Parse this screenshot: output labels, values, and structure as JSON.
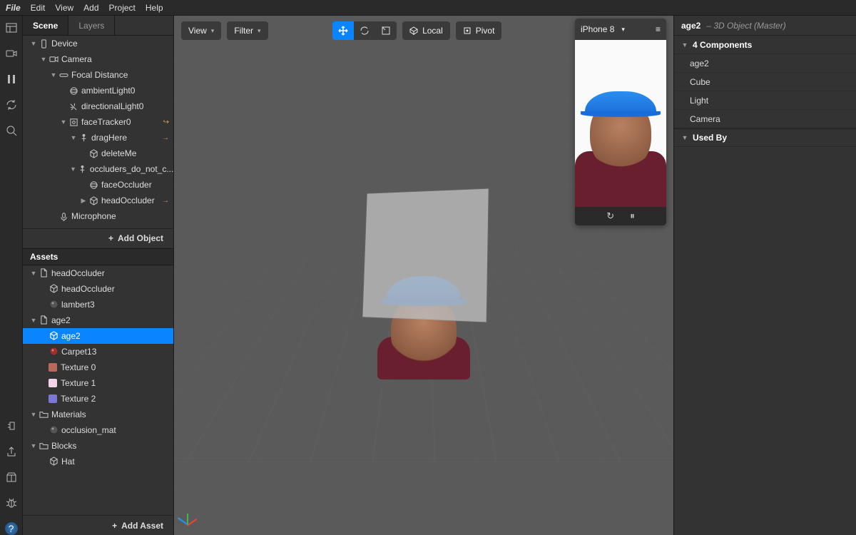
{
  "menu": [
    "File",
    "Edit",
    "View",
    "Add",
    "Project",
    "Help"
  ],
  "leftTools": [
    "layout",
    "camera",
    "pause",
    "rotate",
    "search"
  ],
  "leftToolsBottom": [
    "snap",
    "export",
    "folder",
    "bug",
    "help"
  ],
  "sceneTabs": {
    "scene": "Scene",
    "layers": "Layers"
  },
  "scene": [
    {
      "d": 0,
      "exp": true,
      "icon": "device",
      "label": "Device"
    },
    {
      "d": 1,
      "exp": true,
      "icon": "camera",
      "label": "Camera"
    },
    {
      "d": 2,
      "exp": true,
      "icon": "focal",
      "label": "Focal Distance"
    },
    {
      "d": 3,
      "icon": "sphere",
      "label": "ambientLight0"
    },
    {
      "d": 3,
      "icon": "dirlight",
      "label": "directionalLight0"
    },
    {
      "d": 3,
      "exp": true,
      "icon": "tracker",
      "label": "faceTracker0",
      "tag": "↪"
    },
    {
      "d": 4,
      "exp": true,
      "icon": "null",
      "label": "dragHere",
      "tag": "→"
    },
    {
      "d": 5,
      "icon": "cube",
      "label": "deleteMe"
    },
    {
      "d": 4,
      "exp": true,
      "icon": "null",
      "label": "occluders_do_not_c..."
    },
    {
      "d": 5,
      "icon": "sphere",
      "label": "faceOccluder"
    },
    {
      "d": 5,
      "exp": false,
      "icon": "cube",
      "label": "headOccluder",
      "tag": "→"
    },
    {
      "d": 2,
      "icon": "mic",
      "label": "Microphone"
    }
  ],
  "addObject": "Add Object",
  "assetsTitle": "Assets",
  "assets": [
    {
      "d": 0,
      "exp": true,
      "icon": "file",
      "label": "headOccluder"
    },
    {
      "d": 1,
      "icon": "cube",
      "label": "headOccluder"
    },
    {
      "d": 1,
      "icon": "mat",
      "label": "lambert3"
    },
    {
      "d": 0,
      "exp": true,
      "icon": "file",
      "label": "age2"
    },
    {
      "d": 1,
      "icon": "cube",
      "label": "age2",
      "selected": true
    },
    {
      "d": 1,
      "icon": "redball",
      "label": "Carpet13"
    },
    {
      "d": 1,
      "swatch": "#b86a5a",
      "label": "Texture 0"
    },
    {
      "d": 1,
      "swatch": "#f2d4e6",
      "label": "Texture 1"
    },
    {
      "d": 1,
      "swatch": "#7a78d4",
      "label": "Texture 2"
    },
    {
      "d": 0,
      "exp": true,
      "icon": "folder",
      "label": "Materials"
    },
    {
      "d": 1,
      "icon": "mat",
      "label": "occlusion_mat"
    },
    {
      "d": 0,
      "exp": true,
      "icon": "folder",
      "label": "Blocks"
    },
    {
      "d": 1,
      "icon": "cube",
      "label": "Hat"
    }
  ],
  "addAsset": "Add Asset",
  "topbar": {
    "view": "View",
    "filter": "Filter",
    "localLabel": "Local",
    "pivotLabel": "Pivot",
    "device": "iPhone 8"
  },
  "inspector": {
    "name": "age2",
    "type": "– 3D Object (Master)",
    "componentsTitle": "4 Components",
    "components": [
      "age2",
      "Cube",
      "Light",
      "Camera"
    ],
    "usedBy": "Used By"
  }
}
